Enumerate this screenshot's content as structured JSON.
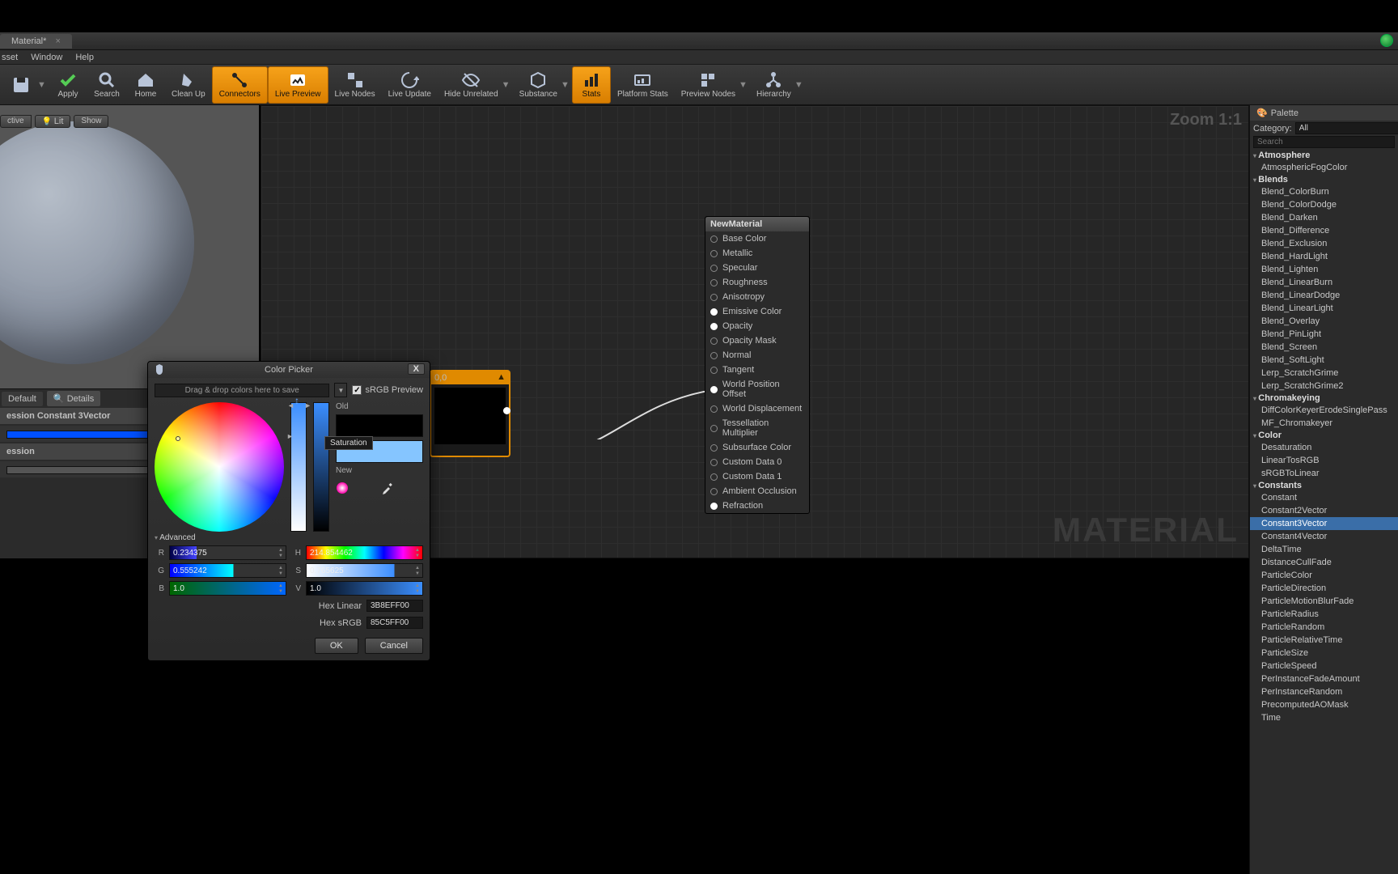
{
  "doc_tab": "Material*",
  "menus": [
    "sset",
    "Window",
    "Help"
  ],
  "toolbar": [
    {
      "label": "",
      "icon": "save"
    },
    {
      "label": "Apply",
      "icon": "check"
    },
    {
      "label": "Search",
      "icon": "search"
    },
    {
      "label": "Home",
      "icon": "home"
    },
    {
      "label": "Clean Up",
      "icon": "broom"
    },
    {
      "label": "Connectors",
      "icon": "connectors",
      "active": true
    },
    {
      "label": "Live Preview",
      "icon": "preview",
      "active": true
    },
    {
      "label": "Live Nodes",
      "icon": "nodes"
    },
    {
      "label": "Live Update",
      "icon": "update"
    },
    {
      "label": "Hide Unrelated",
      "icon": "hide"
    },
    {
      "label": "Substance",
      "icon": "substance"
    },
    {
      "label": "Stats",
      "icon": "stats",
      "active": true
    },
    {
      "label": "Platform Stats",
      "icon": "pstats"
    },
    {
      "label": "Preview Nodes",
      "icon": "pnodes"
    },
    {
      "label": "Hierarchy",
      "icon": "hier"
    }
  ],
  "view_opts": [
    "ctive",
    "Lit",
    "Show"
  ],
  "zoom_label": "Zoom 1:1",
  "watermark": "MATERIAL",
  "mat_node": {
    "title": "NewMaterial",
    "pins": [
      {
        "label": "Base Color",
        "lit": false
      },
      {
        "label": "Metallic",
        "lit": false
      },
      {
        "label": "Specular",
        "lit": false
      },
      {
        "label": "Roughness",
        "lit": false
      },
      {
        "label": "Anisotropy",
        "lit": false
      },
      {
        "label": "Emissive Color",
        "lit": true
      },
      {
        "label": "Opacity",
        "lit": true
      },
      {
        "label": "Opacity Mask",
        "lit": false
      },
      {
        "label": "Normal",
        "lit": false
      },
      {
        "label": "Tangent",
        "lit": false
      },
      {
        "label": "World Position Offset",
        "lit": true
      },
      {
        "label": "World Displacement",
        "lit": false
      },
      {
        "label": "Tessellation Multiplier",
        "lit": false
      },
      {
        "label": "Subsurface Color",
        "lit": false
      },
      {
        "label": "Custom Data 0",
        "lit": false
      },
      {
        "label": "Custom Data 1",
        "lit": false
      },
      {
        "label": "Ambient Occlusion",
        "lit": false
      },
      {
        "label": "Refraction",
        "lit": true
      }
    ]
  },
  "const_node_title": "0,0",
  "details": {
    "tab_default": "Default",
    "tab_details": "Details",
    "header": "ession Constant 3Vector",
    "row": "ession"
  },
  "palette": {
    "title": "Palette",
    "cat_label": "Category:",
    "cat_value": "All",
    "search_ph": "Search",
    "groups": [
      {
        "name": "Atmosphere",
        "items": [
          "AtmosphericFogColor"
        ]
      },
      {
        "name": "Blends",
        "items": [
          "Blend_ColorBurn",
          "Blend_ColorDodge",
          "Blend_Darken",
          "Blend_Difference",
          "Blend_Exclusion",
          "Blend_HardLight",
          "Blend_Lighten",
          "Blend_LinearBurn",
          "Blend_LinearDodge",
          "Blend_LinearLight",
          "Blend_Overlay",
          "Blend_PinLight",
          "Blend_Screen",
          "Blend_SoftLight",
          "Lerp_ScratchGrime",
          "Lerp_ScratchGrime2"
        ]
      },
      {
        "name": "Chromakeying",
        "items": [
          "DiffColorKeyerErodeSinglePass",
          "MF_Chromakeyer"
        ]
      },
      {
        "name": "Color",
        "items": [
          "Desaturation",
          "LinearTosRGB",
          "sRGBToLinear"
        ]
      },
      {
        "name": "Constants",
        "items": [
          "Constant",
          "Constant2Vector",
          "Constant3Vector",
          "Constant4Vector",
          "DeltaTime",
          "DistanceCullFade",
          "ParticleColor",
          "ParticleDirection",
          "ParticleMotionBlurFade",
          "ParticleRadius",
          "ParticleRandom",
          "ParticleRelativeTime",
          "ParticleSize",
          "ParticleSpeed",
          "PerInstanceFadeAmount",
          "PerInstanceRandom",
          "PrecomputedAOMask",
          "Time"
        ]
      }
    ],
    "selected": "Constant3Vector"
  },
  "picker": {
    "title": "Color Picker",
    "drag_hint": "Drag & drop colors here to save",
    "srgb_label": "sRGB Preview",
    "old_label": "Old",
    "new_label": "New",
    "tooltip": "Saturation",
    "advanced": "Advanced",
    "R": "0.234375",
    "G": "0.555242",
    "B": "1.0",
    "H": "214.854462",
    "S": "0.765625",
    "V": "1.0",
    "hex_linear_label": "Hex Linear",
    "hex_linear": "3B8EFF00",
    "hex_srgb_label": "Hex sRGB",
    "hex_srgb": "85C5FF00",
    "ok": "OK",
    "cancel": "Cancel",
    "new_color": "#85C5FF"
  }
}
